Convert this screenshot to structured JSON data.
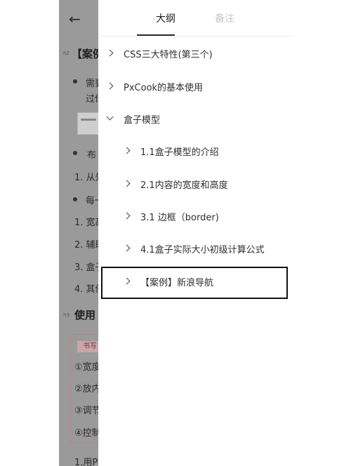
{
  "tabs": {
    "outline": "大纲",
    "notes": "备注"
  },
  "outline": {
    "items": [
      {
        "label": "CSS三大特性(第三个)"
      },
      {
        "label": "PxCook的基本使用"
      },
      {
        "label": "盒子模型"
      },
      {
        "label": "1.1盒子模型的介绍"
      },
      {
        "label": "2.1内容的宽度和高度"
      },
      {
        "label": "3.1 边框（border)"
      },
      {
        "label": "4.1盒子实际大小初级计算公式"
      },
      {
        "label": "【案例】新浪导航"
      }
    ]
  },
  "doc": {
    "heading1": "【案例",
    "heading1_level": "h2",
    "bullet1_line1": "需要",
    "bullet1_line2": "过你",
    "bullet2": "布",
    "list1": [
      "1. 从外",
      "1. 宽高",
      "2. 辅助",
      "3. 盒子",
      "4. 其他"
    ],
    "bullet3": "每一",
    "heading2": "使用",
    "heading2_level": "h3",
    "tag": "书写",
    "steps": [
      "①宽度",
      "②放内",
      "③调节",
      "④控制"
    ],
    "footer": "1.用P"
  },
  "colors": {
    "overlay": "#9a9a9a",
    "panel": "#ffffff",
    "highlight_border": "#111111",
    "tab_inactive": "#c6c6c6"
  },
  "icons": {
    "back": "arrow-left-icon",
    "collapsed": "chevron-right-icon",
    "expanded": "chevron-down-icon"
  }
}
